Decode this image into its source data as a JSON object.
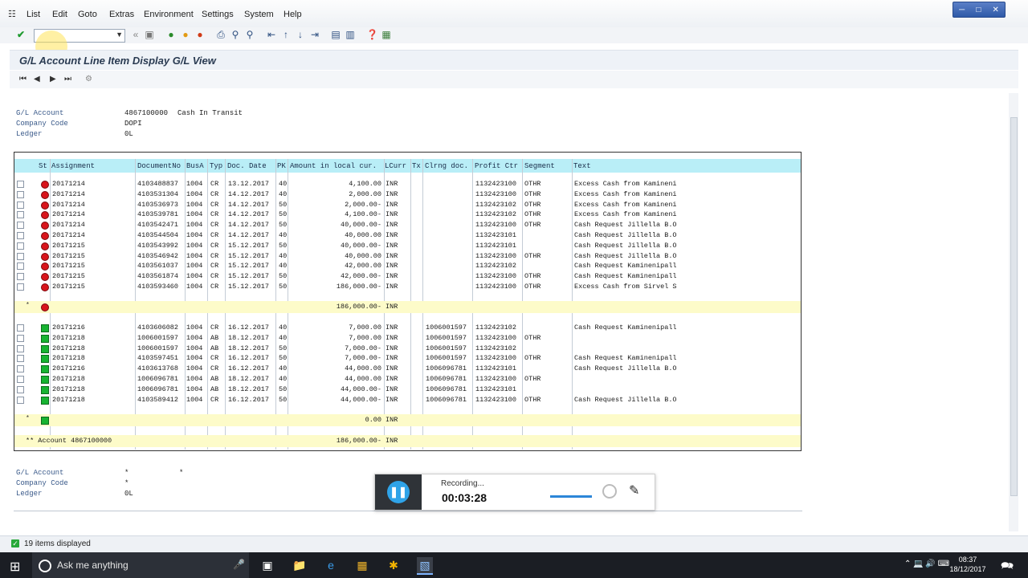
{
  "menu": [
    "List",
    "Edit",
    "Goto",
    "Extras",
    "Environment",
    "Settings",
    "System",
    "Help"
  ],
  "title": "G/L Account Line Item Display G/L View",
  "header": {
    "gl_account_label": "G/L Account",
    "gl_account_value": "4867100000",
    "gl_account_desc": "Cash In Transit",
    "company_code_label": "Company Code",
    "company_code_value": "DOPI",
    "ledger_label": "Ledger",
    "ledger_value": "0L"
  },
  "table": {
    "columns": [
      "St",
      "Assignment",
      "DocumentNo",
      "BusA",
      "Typ",
      "Doc. Date",
      "PK",
      "Amount in local cur.",
      "LCurr",
      "Tx",
      "Clrng doc.",
      "Profit Ctr",
      "Segment",
      "Text"
    ],
    "open_items": [
      [
        "20171214",
        "4103488837",
        "1004",
        "CR",
        "13.12.2017",
        "40",
        "4,100.00",
        "INR",
        "",
        "",
        "1132423100",
        "OTHR",
        "Excess Cash from Kamineni"
      ],
      [
        "20171214",
        "4103531304",
        "1004",
        "CR",
        "14.12.2017",
        "40",
        "2,000.00",
        "INR",
        "",
        "",
        "1132423100",
        "OTHR",
        "Excess Cash from Kamineni"
      ],
      [
        "20171214",
        "4103536973",
        "1004",
        "CR",
        "14.12.2017",
        "50",
        "2,000.00-",
        "INR",
        "",
        "",
        "1132423102",
        "OTHR",
        "Excess Cash from Kamineni"
      ],
      [
        "20171214",
        "4103539781",
        "1004",
        "CR",
        "14.12.2017",
        "50",
        "4,100.00-",
        "INR",
        "",
        "",
        "1132423102",
        "OTHR",
        "Excess Cash from Kamineni"
      ],
      [
        "20171214",
        "4103542471",
        "1004",
        "CR",
        "14.12.2017",
        "50",
        "40,000.00-",
        "INR",
        "",
        "",
        "1132423100",
        "OTHR",
        "Cash Request Jillella B.O"
      ],
      [
        "20171214",
        "4103544504",
        "1004",
        "CR",
        "14.12.2017",
        "40",
        "40,000.00",
        "INR",
        "",
        "",
        "1132423101",
        "",
        "Cash Request Jillella B.O"
      ],
      [
        "20171215",
        "4103543992",
        "1004",
        "CR",
        "15.12.2017",
        "50",
        "40,000.00-",
        "INR",
        "",
        "",
        "1132423101",
        "",
        "Cash Request Jillella B.O"
      ],
      [
        "20171215",
        "4103546942",
        "1004",
        "CR",
        "15.12.2017",
        "40",
        "40,000.00",
        "INR",
        "",
        "",
        "1132423100",
        "OTHR",
        "Cash Request Jillella B.O"
      ],
      [
        "20171215",
        "4103561037",
        "1004",
        "CR",
        "15.12.2017",
        "40",
        "42,000.00",
        "INR",
        "",
        "",
        "1132423102",
        "",
        "Cash Request Kaminenipall"
      ],
      [
        "20171215",
        "4103561874",
        "1004",
        "CR",
        "15.12.2017",
        "50",
        "42,000.00-",
        "INR",
        "",
        "",
        "1132423100",
        "OTHR",
        "Cash Request Kaminenipall"
      ],
      [
        "20171215",
        "4103593460",
        "1004",
        "CR",
        "15.12.2017",
        "50",
        "186,000.00-",
        "INR",
        "",
        "",
        "1132423100",
        "OTHR",
        "Excess Cash from Sirvel S"
      ]
    ],
    "open_total": {
      "star": "*",
      "amount": "186,000.00-",
      "currency": "INR"
    },
    "cleared_items": [
      [
        "20171216",
        "4103606082",
        "1004",
        "CR",
        "16.12.2017",
        "40",
        "7,000.00",
        "INR",
        "",
        "1006001597",
        "1132423102",
        "",
        "Cash Request Kaminenipall"
      ],
      [
        "20171218",
        "1006001597",
        "1004",
        "AB",
        "18.12.2017",
        "40",
        "7,000.00",
        "INR",
        "",
        "1006001597",
        "1132423100",
        "OTHR",
        ""
      ],
      [
        "20171218",
        "1006001597",
        "1004",
        "AB",
        "18.12.2017",
        "50",
        "7,000.00-",
        "INR",
        "",
        "1006001597",
        "1132423102",
        "",
        ""
      ],
      [
        "20171218",
        "4103597451",
        "1004",
        "CR",
        "16.12.2017",
        "50",
        "7,000.00-",
        "INR",
        "",
        "1006001597",
        "1132423100",
        "OTHR",
        "Cash Request Kaminenipall"
      ],
      [
        "20171216",
        "4103613768",
        "1004",
        "CR",
        "16.12.2017",
        "40",
        "44,000.00",
        "INR",
        "",
        "1006096781",
        "1132423101",
        "",
        "Cash Request Jillella B.O"
      ],
      [
        "20171218",
        "1006096781",
        "1004",
        "AB",
        "18.12.2017",
        "40",
        "44,000.00",
        "INR",
        "",
        "1006096781",
        "1132423100",
        "OTHR",
        ""
      ],
      [
        "20171218",
        "1006096781",
        "1004",
        "AB",
        "18.12.2017",
        "50",
        "44,000.00-",
        "INR",
        "",
        "1006096781",
        "1132423101",
        "",
        ""
      ],
      [
        "20171218",
        "4103589412",
        "1004",
        "CR",
        "16.12.2017",
        "50",
        "44,000.00-",
        "INR",
        "",
        "1006096781",
        "1132423100",
        "OTHR",
        "Cash Request Jillella B.O"
      ]
    ],
    "cleared_total": {
      "star": "*",
      "amount": "0.00",
      "currency": "INR"
    },
    "account_total": {
      "label": "** Account 4867100000",
      "amount": "186,000.00-",
      "currency": "INR"
    }
  },
  "footer": {
    "gl_account_label": "G/L Account",
    "gl_account_value": "*",
    "gl_account_value2": "*",
    "company_code_label": "Company Code",
    "company_code_value": "*",
    "ledger_label": "Ledger",
    "ledger_value": "0L"
  },
  "status": {
    "message": "19 items displayed"
  },
  "recorder": {
    "label": "Recording...",
    "time": "00:03:28"
  },
  "taskbar": {
    "search_placeholder": "Ask me anything",
    "time": "08:37",
    "date": "18/12/2017"
  }
}
